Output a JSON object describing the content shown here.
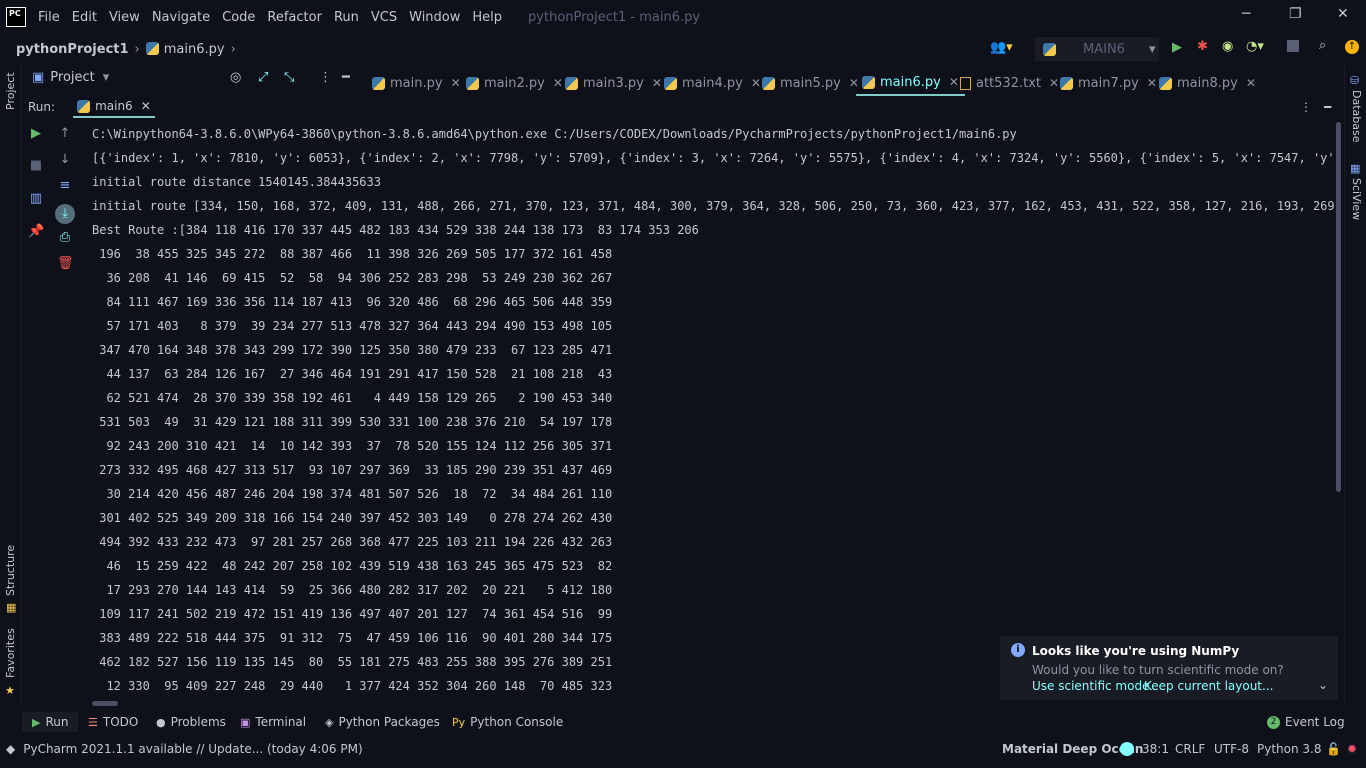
{
  "menubar": {
    "items": [
      "File",
      "Edit",
      "View",
      "Navigate",
      "Code",
      "Refactor",
      "Run",
      "VCS",
      "Window",
      "Help"
    ],
    "window_title": "pythonProject1 - main6.py",
    "minimize": "─",
    "restore": "❐",
    "close": "✕"
  },
  "navbar": {
    "project": "pythonProject1",
    "file": "main6.py",
    "run_config": "MAIN6"
  },
  "project_panel": {
    "label": "Project"
  },
  "tabs": [
    {
      "label": "main.py"
    },
    {
      "label": "main2.py"
    },
    {
      "label": "main3.py"
    },
    {
      "label": "main4.py"
    },
    {
      "label": "main5.py"
    },
    {
      "label": "main6.py"
    },
    {
      "label": "att532.txt"
    },
    {
      "label": "main7.py"
    },
    {
      "label": "main8.py"
    }
  ],
  "run_panel": {
    "label": "Run:",
    "tab": "main6"
  },
  "console_lines": [
    "C:\\Winpython64-3.8.6.0\\WPy64-3860\\python-3.8.6.amd64\\python.exe C:/Users/CODEX/Downloads/PycharmProjects/pythonProject1/main6.py",
    "[{'index': 1, 'x': 7810, 'y': 6053}, {'index': 2, 'x': 7798, 'y': 5709}, {'index': 3, 'x': 7264, 'y': 5575}, {'index': 4, 'x': 7324, 'y': 5560}, {'index': 5, 'x': 7547, 'y': 5503",
    "initial route distance 1540145.384435633",
    "initial route [334, 150, 168, 372, 409, 131, 488, 266, 271, 370, 123, 371, 484, 300, 379, 364, 328, 506, 250, 73, 360, 423, 377, 162, 453, 431, 522, 358, 127, 216, 193, 269, 117, 48",
    "Best Route :[384 118 416 170 337 445 482 183 434 529 338 244 138 173  83 174 353 206",
    " 196  38 455 325 345 272  88 387 466  11 398 326 269 505 177 372 161 458",
    "  36 208  41 146  69 415  52  58  94 306 252 283 298  53 249 230 362 267",
    "  84 111 467 169 336 356 114 187 413  96 320 486  68 296 465 506 448 359",
    "  57 171 403   8 379  39 234 277 513 478 327 364 443 294 490 153 498 105",
    " 347 470 164 348 378 343 299 172 390 125 350 380 479 233  67 123 285 471",
    "  44 137  63 284 126 167  27 346 464 191 291 417 150 528  21 108 218  43",
    "  62 521 474  28 370 339 358 192 461   4 449 158 129 265   2 190 453 340",
    " 531 503  49  31 429 121 188 311 399 530 331 100 238 376 210  54 197 178",
    "  92 243 200 310 421  14  10 142 393  37  78 520 155 124 112 256 305 371",
    " 273 332 495 468 427 313 517  93 107 297 369  33 185 290 239 351 437 469",
    "  30 214 420 456 487 246 204 198 374 481 507 526  18  72  34 484 261 110",
    " 301 402 525 349 209 318 166 154 240 397 452 303 149   0 278 274 262 430",
    " 494 392 433 232 473  97 281 257 268 368 477 225 103 211 194 226 432 263",
    "  46  15 259 422  48 242 207 258 102 439 519 438 163 245 365 475 523  82",
    "  17 293 270 144 143 414  59  25 366 480 282 317 202  20 221   5 412 180",
    " 109 117 241 502 219 472 151 419 136 497 407 201 127  74 361 454 516  99",
    " 383 489 222 518 444 375  91 312  75  47 459 106 116  90 401 280 344 175",
    " 462 182 527 156 119 135 145  80  55 181 275 483 255 388 395 276 389 251",
    "  12 330  95 409 227 248  29 440   1 377 424 352 304 260 148  70 485 323"
  ],
  "notification": {
    "title": "Looks like you're using NumPy",
    "body": "Would you like to turn scientific mode on?",
    "link1": "Use scientific mode",
    "link2": "Keep current layout..."
  },
  "bottom_tools": {
    "run": "Run",
    "todo": "TODO",
    "problems": "Problems",
    "terminal": "Terminal",
    "packages": "Python Packages",
    "console": "Python Console",
    "event_log": "Event Log",
    "event_count": "2"
  },
  "side_labels": {
    "project": "Project",
    "structure": "Structure",
    "favorites": "Favorites",
    "database": "Database",
    "sciview": "SciView"
  },
  "statusbar": {
    "update": "PyCharm 2021.1.1 available // Update... (today 4:06 PM)",
    "theme": "Material Deep Ocean",
    "position": "38:1",
    "line_sep": "CRLF",
    "encoding": "UTF-8",
    "interpreter": "Python 3.8"
  },
  "colors": {
    "background": "#0f111a",
    "accent": "#84ffff",
    "text": "#c3c7d1"
  }
}
